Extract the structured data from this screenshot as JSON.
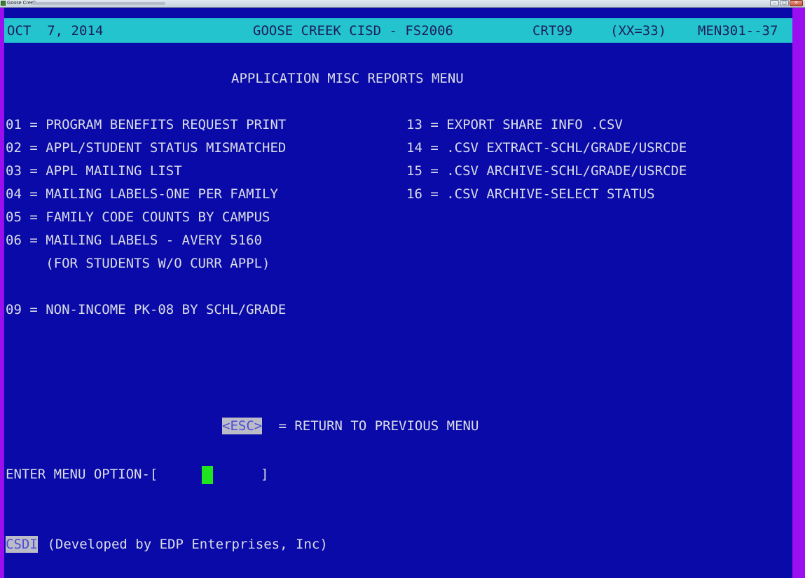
{
  "window": {
    "title": "Goose Creek"
  },
  "status_bar": {
    "date": "OCT  7, 2014",
    "system": "GOOSE CREEK CISD - FS2006",
    "terminal": "CRT99",
    "session": "(XX=33)",
    "menu_code": "MEN301--37"
  },
  "menu": {
    "title": "APPLICATION MISC REPORTS MENU",
    "left_items": [
      "01 = PROGRAM BENEFITS REQUEST PRINT",
      "02 = APPL/STUDENT STATUS MISMATCHED",
      "03 = APPL MAILING LIST",
      "04 = MAILING LABELS-ONE PER FAMILY",
      "05 = FAMILY CODE COUNTS BY CAMPUS",
      "06 = MAILING LABELS - AVERY 5160",
      "     (FOR STUDENTS W/O CURR APPL)",
      "09 = NON-INCOME PK-08 BY SCHL/GRADE"
    ],
    "right_items": [
      "13 = EXPORT SHARE INFO .CSV",
      "14 = .CSV EXTRACT-SCHL/GRADE/USRCDE",
      "15 = .CSV ARCHIVE-SCHL/GRADE/USRCDE",
      "16 = .CSV ARCHIVE-SELECT STATUS"
    ]
  },
  "esc": {
    "key": "<ESC>",
    "text": " = RETURN TO PREVIOUS MENU"
  },
  "prompt": {
    "label": "ENTER MENU OPTION-[",
    "close": "]"
  },
  "footer": {
    "brand": "CSDI",
    "text": " (Developed by EDP Enterprises, Inc)"
  },
  "colors": {
    "background": "#0a0aa8",
    "status_bar": "#24c4ce",
    "frame": "#9a0ff0",
    "cursor": "#1ee51e"
  }
}
